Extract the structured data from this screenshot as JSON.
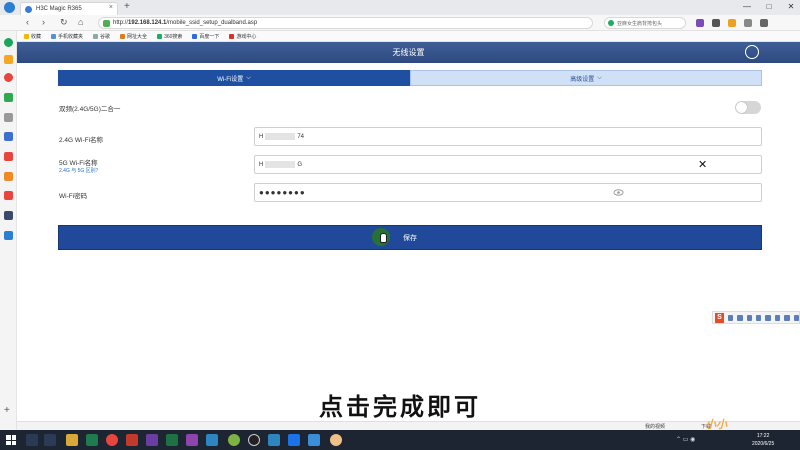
{
  "browser": {
    "tab_title": "H3C Magic R365",
    "tab_close": "×",
    "new_tab": "+",
    "window_controls": [
      "—",
      "□",
      "✕"
    ],
    "url_prefix": "http://",
    "url_host": "192.168.124.1",
    "url_path": "/mobile_ssid_setup_dualband.asp",
    "search_placeholder": "亚麻女生肩背挎包头",
    "bookmarks": [
      "收藏",
      "手机收藏夹",
      "谷歌",
      "网址大全",
      "360搜索",
      "百度一下",
      "游戏中心"
    ]
  },
  "page": {
    "header_title": "无线设置",
    "tabs": {
      "wifi_label": "Wi-Fi设置",
      "advanced_label": "高级设置",
      "chevron": "⌵"
    },
    "dual_band": {
      "label": "双频(2.4G/5G)二合一",
      "enabled": false
    },
    "wifi_24": {
      "label": "2.4G Wi-Fi名称",
      "value_start": "H",
      "value_end": "74"
    },
    "wifi_5": {
      "label": "5G Wi-Fi名称",
      "sub_link": "2.4G 与 5G 区别？",
      "value_start": "H",
      "value_end": "G",
      "clear_symbol": "✕"
    },
    "wifi_password": {
      "label": "Wi-Fi密码",
      "masked_value": "●●●●●●●●"
    },
    "save_label": "保存"
  },
  "float_toolbar": {
    "logo_letter": "S"
  },
  "caption": "点击完成即可",
  "status_bar": {
    "left": "我的视频",
    "right": "下载"
  },
  "taskbar": {
    "time": "17:22",
    "date": "2020/6/25"
  },
  "watermark": "小小"
}
